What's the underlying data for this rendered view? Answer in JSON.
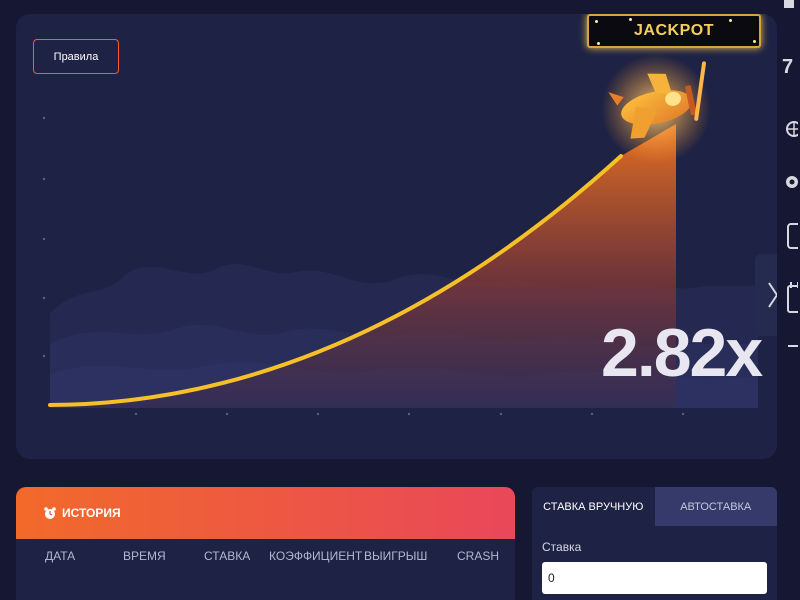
{
  "game": {
    "rules_label": "Правила",
    "jackpot_label": "JACKPOT",
    "multiplier": "2.82x"
  },
  "side": {
    "top_value": "7"
  },
  "history": {
    "title": "ИСТОРИЯ",
    "columns": [
      "ДАТА",
      "ВРЕМЯ",
      "СТАВКА",
      "КОЭФФИЦИЕНТ",
      "ВЫИГРЫШ",
      "CRASH"
    ]
  },
  "bet": {
    "tabs": [
      "СТАВКА ВРУЧНУЮ",
      "АВТОСТАВКА"
    ],
    "stake_label": "Ставка",
    "stake_value": "0"
  },
  "colors": {
    "background": "#151733",
    "panel": "#1e2244",
    "accent_orange": "#ff5a2b",
    "curve": "#f5c028",
    "jackpot_gold": "#f4cf5a"
  }
}
